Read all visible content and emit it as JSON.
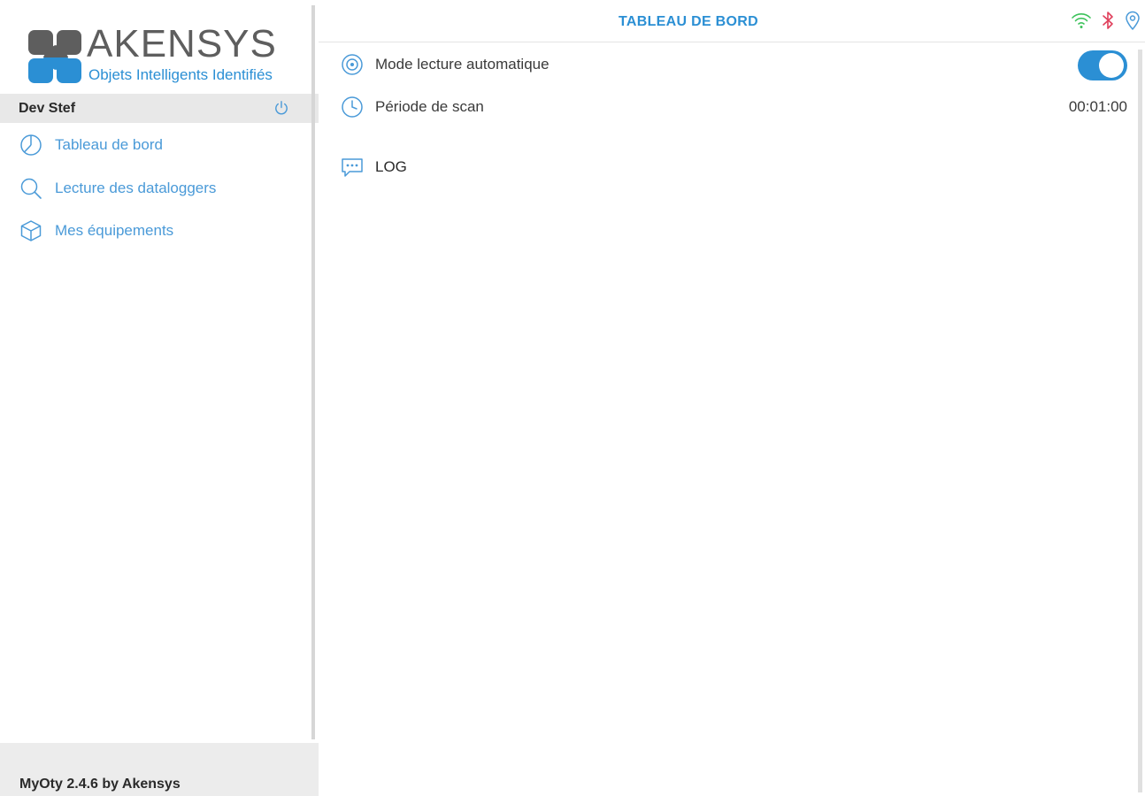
{
  "brand": {
    "name": "AKENSYS",
    "tagline": "Objets Intelligents Identifiés"
  },
  "user": {
    "name": "Dev Stef"
  },
  "sidebar": {
    "items": [
      {
        "label": "Tableau de bord",
        "icon": "pie-chart-icon"
      },
      {
        "label": "Lecture des dataloggers",
        "icon": "search-icon"
      },
      {
        "label": "Mes équipements",
        "icon": "box-icon"
      }
    ]
  },
  "footer": {
    "version": "MyOty 2.4.6 by Akensys"
  },
  "header": {
    "title": "TABLEAU DE BORD",
    "status_icons": [
      "wifi-icon",
      "bluetooth-icon",
      "location-icon"
    ]
  },
  "main": {
    "auto_read": {
      "label": "Mode lecture automatique",
      "enabled": true
    },
    "scan_period": {
      "label": "Période de scan",
      "value": "00:01:00"
    },
    "log": {
      "label": "LOG"
    }
  },
  "colors": {
    "accent": "#2b8fd4",
    "nav_text": "#4a9ad8",
    "wifi": "#3cc25a",
    "bluetooth": "#e0405c",
    "location": "#4a9ad8"
  }
}
